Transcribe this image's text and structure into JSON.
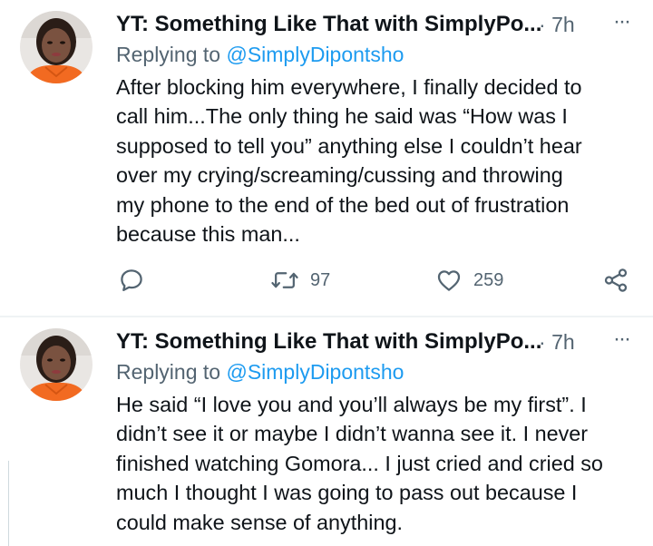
{
  "tweets": [
    {
      "author_name": "YT: Something Like That with SimplyPo...",
      "separator": "·",
      "time": "7h",
      "more": "···",
      "replying_prefix": "Replying to",
      "replying_handle": "@SimplyDipontsho",
      "lines": [
        "After blocking him everywhere, I finally decided to",
        "call him...The only thing he said was “How was I",
        "supposed to tell you” anything else I couldn’t hear",
        "over my crying/screaming/cussing and throwing",
        "my phone to the end of the bed out of frustration",
        "because this man..."
      ],
      "actions": {
        "reply_icon": "reply-icon",
        "retweet_icon": "retweet-icon",
        "retweet_count": "97",
        "like_icon": "heart-icon",
        "like_count": "259",
        "share_icon": "share-icon"
      }
    },
    {
      "author_name": "YT: Something Like That with SimplyPo...",
      "separator": "·",
      "time": "7h",
      "more": "···",
      "replying_prefix": "Replying to",
      "replying_handle": "@SimplyDipontsho",
      "lines": [
        "He said “I love you and you’ll always be my first”. I",
        "didn’t see it or maybe I didn’t wanna see it. I never",
        "finished watching Gomora... I just cried and cried so",
        "much I thought I was going to pass out because I",
        "could make sense of anything."
      ]
    }
  ],
  "colors": {
    "text": "#0f1419",
    "secondary": "#536471",
    "link": "#1d9bf0",
    "divider": "#eff3f4",
    "avatar_jacket": "#f26a21"
  }
}
